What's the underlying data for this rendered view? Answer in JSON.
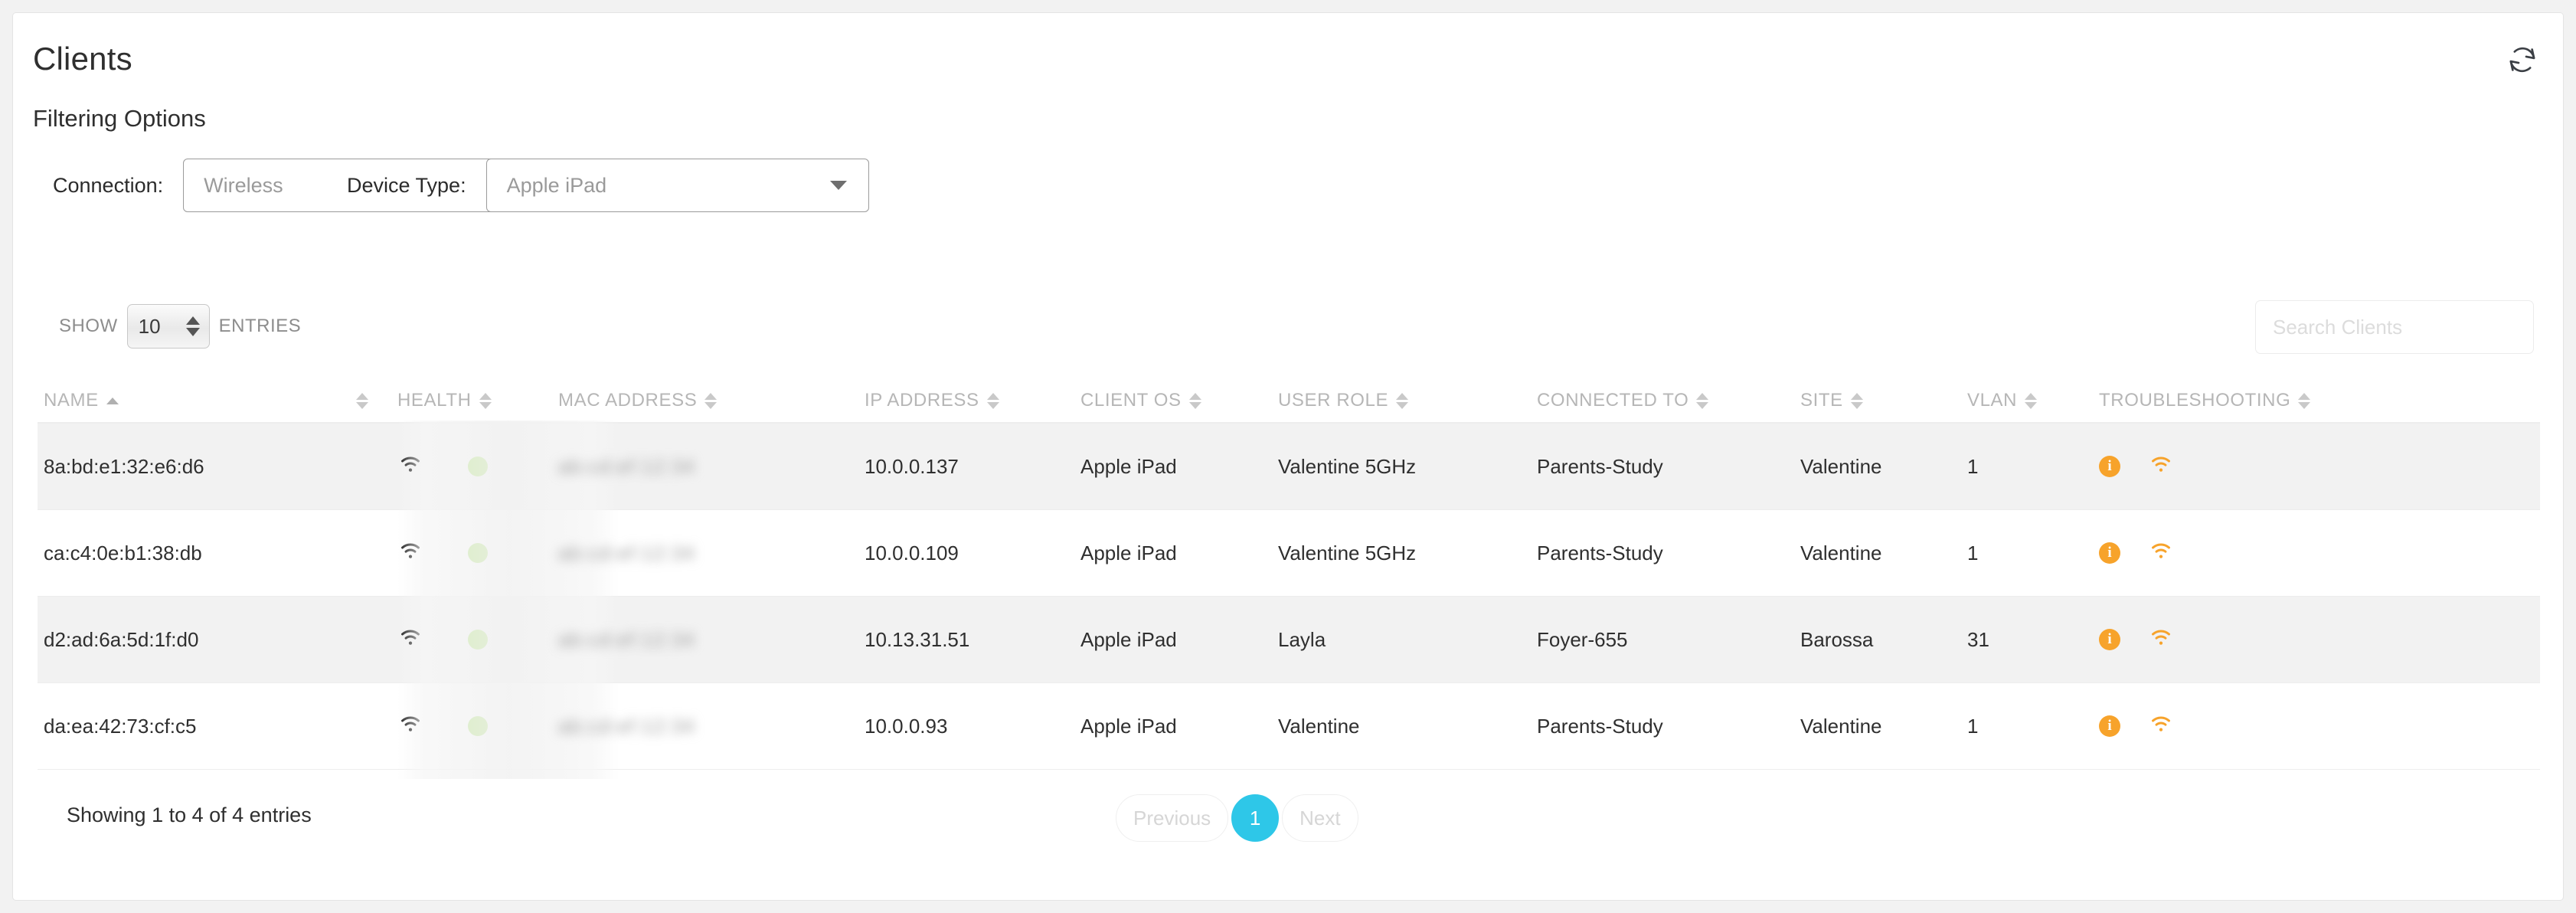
{
  "page": {
    "title": "Clients",
    "filtering_title": "Filtering Options",
    "refresh_icon": "refresh-icon"
  },
  "filters": {
    "connection": {
      "label": "Connection:",
      "value": "Wireless",
      "caret_icon": "chevron-down-icon"
    },
    "device_type": {
      "label": "Device Type:",
      "value": "Apple iPad",
      "caret_icon": "chevron-down-icon"
    }
  },
  "controls": {
    "show_label": "SHOW",
    "entries_label": "ENTRIES",
    "entries_value": "10",
    "search_placeholder": "Search Clients",
    "search_value": ""
  },
  "table": {
    "columns": [
      {
        "key": "name",
        "label": "NAME",
        "sort": "asc"
      },
      {
        "key": "health",
        "label": "HEALTH",
        "sort": "none"
      },
      {
        "key": "mac",
        "label": "MAC ADDRESS",
        "sort": "none"
      },
      {
        "key": "ip",
        "label": "IP ADDRESS",
        "sort": "none"
      },
      {
        "key": "os",
        "label": "CLIENT OS",
        "sort": "none"
      },
      {
        "key": "role",
        "label": "USER ROLE",
        "sort": "none"
      },
      {
        "key": "connected_to",
        "label": "CONNECTED TO",
        "sort": "none"
      },
      {
        "key": "site",
        "label": "SITE",
        "sort": "none"
      },
      {
        "key": "vlan",
        "label": "VLAN",
        "sort": "none"
      },
      {
        "key": "troubleshooting",
        "label": "TROUBLESHOOTING",
        "sort": "none"
      }
    ],
    "rows": [
      {
        "name": "8a:bd:e1:32:e6:d6",
        "connection_icon": "wifi-icon",
        "health": "green",
        "mac": "redacted",
        "ip": "10.0.0.137",
        "os": "Apple iPad",
        "role": "Valentine 5GHz",
        "connected_to": "Parents-Study",
        "site": "Valentine",
        "vlan": "1",
        "troubleshooting_info_icon": "info-icon",
        "troubleshooting_wifi_icon": "wifi-icon"
      },
      {
        "name": "ca:c4:0e:b1:38:db",
        "connection_icon": "wifi-icon",
        "health": "green",
        "mac": "redacted",
        "ip": "10.0.0.109",
        "os": "Apple iPad",
        "role": "Valentine 5GHz",
        "connected_to": "Parents-Study",
        "site": "Valentine",
        "vlan": "1",
        "troubleshooting_info_icon": "info-icon",
        "troubleshooting_wifi_icon": "wifi-icon"
      },
      {
        "name": "d2:ad:6a:5d:1f:d0",
        "connection_icon": "wifi-icon",
        "health": "green",
        "mac": "redacted",
        "ip": "10.13.31.51",
        "os": "Apple iPad",
        "role": "Layla",
        "connected_to": "Foyer-655",
        "site": "Barossa",
        "vlan": "31",
        "troubleshooting_info_icon": "info-icon",
        "troubleshooting_wifi_icon": "wifi-icon"
      },
      {
        "name": "da:ea:42:73:cf:c5",
        "connection_icon": "wifi-icon",
        "health": "green",
        "mac": "redacted",
        "ip": "10.0.0.93",
        "os": "Apple iPad",
        "role": "Valentine",
        "connected_to": "Parents-Study",
        "site": "Valentine",
        "vlan": "1",
        "troubleshooting_info_icon": "info-icon",
        "troubleshooting_wifi_icon": "wifi-icon"
      }
    ]
  },
  "footer": {
    "showing": "Showing 1 to 4 of 4 entries",
    "previous": "Previous",
    "next": "Next",
    "pages": [
      "1"
    ],
    "current_page": "1"
  },
  "colors": {
    "link": "#3ec8ea",
    "health_green": "#7ed321",
    "warning_orange": "#f7a32b",
    "pager_active": "#2ec7e8"
  }
}
